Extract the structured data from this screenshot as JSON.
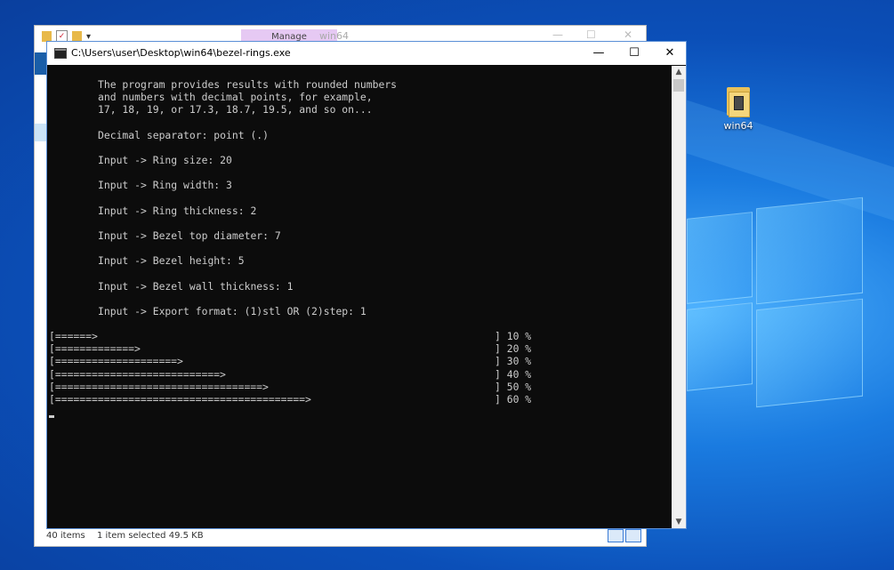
{
  "desktop": {
    "icon_label": "win64"
  },
  "explorer": {
    "ribbon_tab": "Manage",
    "title": "win64",
    "status_items": "40 items",
    "status_selected": "1 item selected  49.5 KB"
  },
  "console": {
    "title": "C:\\Users\\user\\Desktop\\win64\\bezel-rings.exe",
    "controls": {
      "minimize": "—",
      "maximize": "☐",
      "close": "✕"
    },
    "intro": [
      "The program provides results with rounded numbers",
      "and numbers with decimal points, for example,",
      "17, 18, 19, or 17.3, 18.7, 19.5, and so on..."
    ],
    "separator": "Decimal separator: point (.)",
    "inputs": [
      "Input -> Ring size: 20",
      "Input -> Ring width: 3",
      "Input -> Ring thickness: 2",
      "Input -> Bezel top diameter: 7",
      "Input -> Bezel height: 5",
      "Input -> Bezel wall thickness: 1",
      "Input -> Export format: (1)stl OR (2)step: 1"
    ],
    "progress": [
      {
        "bar": "[======>",
        "pct": "] 10 %"
      },
      {
        "bar": "[=============>",
        "pct": "] 20 %"
      },
      {
        "bar": "[====================>",
        "pct": "] 30 %"
      },
      {
        "bar": "[===========================>",
        "pct": "] 40 %"
      },
      {
        "bar": "[==================================>",
        "pct": "] 50 %"
      },
      {
        "bar": "[=========================================>",
        "pct": "] 60 %"
      }
    ]
  },
  "colors": {
    "console_bg": "#0c0c0c",
    "console_text": "#cccccc",
    "desktop_blue": "#0b4fb8"
  }
}
